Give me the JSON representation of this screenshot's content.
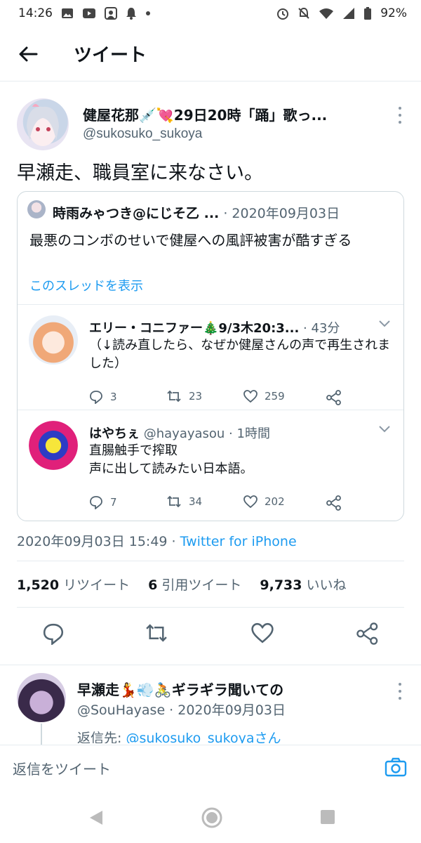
{
  "status_bar": {
    "time": "14:26",
    "battery": "92%",
    "left_icons": [
      "image-icon",
      "youtube-icon",
      "app-icon",
      "bell-icon",
      "dot-icon"
    ],
    "right_icons": [
      "alarm-icon",
      "mute-icon",
      "wifi-icon",
      "signal-icon",
      "battery-icon"
    ]
  },
  "header": {
    "title": "ツイート",
    "back_icon": "arrow-left-icon"
  },
  "tweet": {
    "author_name": "健屋花那💉💘29日20時「踊」歌っ...",
    "author_handle": "@sukosuko_sukoya",
    "text": "早瀬走、職員室に来なさい。",
    "timestamp": "2020年09月03日 15:49 · ",
    "source": "Twitter for iPhone",
    "stats": {
      "retweets_count": "1,520",
      "retweets_label": "リツイート",
      "quotes_count": "6",
      "quotes_label": "引用ツイート",
      "likes_count": "9,733",
      "likes_label": "いいね"
    },
    "actions": [
      "reply-icon",
      "retweet-icon",
      "like-icon",
      "share-icon"
    ]
  },
  "quoted": {
    "author_name": "時雨みゃつき@にじそ乙 ...",
    "meta": " · 2020年09月03日",
    "text": "最悪のコンボのせいで健屋への風評被害が酷すぎる",
    "thread_link": "このスレッドを表示",
    "replies": [
      {
        "name": "エリー・コニファー🎄9/3木20:3...",
        "meta": " · 43分",
        "text": "（↓読み直したら、なぜか健屋さんの声で再生されました）",
        "reply_count": "3",
        "retweet_count": "23",
        "like_count": "259",
        "avatar_color": "#f4c9a8"
      },
      {
        "name": "はやちぇ",
        "meta": " @hayayasou · 1時間",
        "text": "直腸触手で搾取\n声に出して読みたい日本語。",
        "reply_count": "7",
        "retweet_count": "34",
        "like_count": "202",
        "avatar_color": "#e0207a"
      }
    ]
  },
  "reply_tweet": {
    "author_name": "早瀬走💃💨🚴ギラギラ聞いての",
    "author_handle": "@SouHayase · 2020年09月03日",
    "reply_to_label": "返信先: ",
    "reply_to_link": "@sukosuko_sukoyaさん"
  },
  "compose": {
    "placeholder": "返信をツイート",
    "camera_icon": "camera-icon"
  },
  "navbar": [
    "nav-back-icon",
    "nav-home-icon",
    "nav-recents-icon"
  ],
  "colors": {
    "accent": "#1d9bf0",
    "text": "#0f1419",
    "muted": "#536471",
    "border": "#cfd9de"
  }
}
